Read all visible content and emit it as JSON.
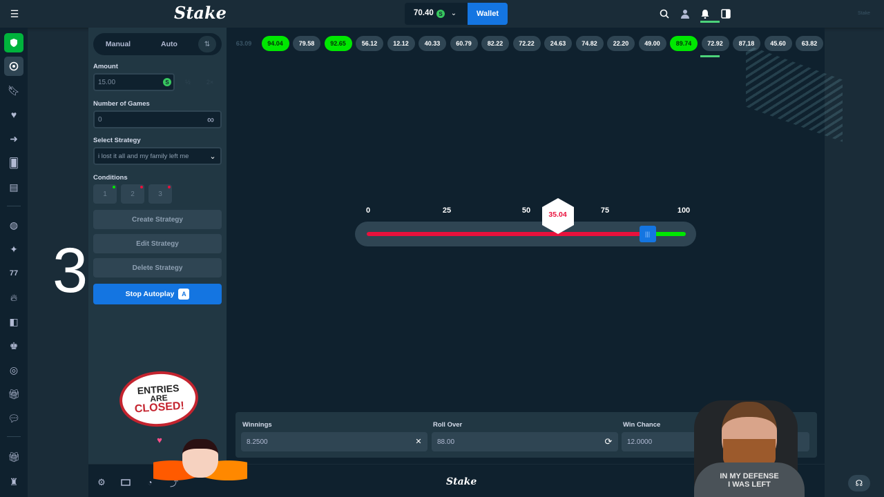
{
  "header": {
    "logo": "Stake",
    "balance": "70.40",
    "currency_symbol": "S",
    "wallet_label": "Wallet",
    "corner_text": "Stake"
  },
  "recent_results": [
    {
      "value": "63.09",
      "win": false,
      "faded": true
    },
    {
      "value": "94.04",
      "win": true
    },
    {
      "value": "79.58",
      "win": false
    },
    {
      "value": "92.65",
      "win": true
    },
    {
      "value": "56.12",
      "win": false
    },
    {
      "value": "12.12",
      "win": false
    },
    {
      "value": "40.33",
      "win": false
    },
    {
      "value": "60.79",
      "win": false
    },
    {
      "value": "82.22",
      "win": false
    },
    {
      "value": "72.22",
      "win": false
    },
    {
      "value": "24.63",
      "win": false
    },
    {
      "value": "74.82",
      "win": false
    },
    {
      "value": "22.20",
      "win": false
    },
    {
      "value": "49.00",
      "win": false
    },
    {
      "value": "89.74",
      "win": true
    },
    {
      "value": "72.92",
      "win": false
    },
    {
      "value": "87.18",
      "win": false
    },
    {
      "value": "45.60",
      "win": false
    },
    {
      "value": "63.82",
      "win": false
    }
  ],
  "bet_panel": {
    "tab_manual": "Manual",
    "tab_auto": "Auto",
    "amount_label": "Amount",
    "amount_value": "15.00",
    "half_label": "½",
    "double_label": "2×",
    "games_label": "Number of Games",
    "games_value": "0",
    "strategy_label": "Select Strategy",
    "strategy_value": "i lost it all and my family left me",
    "conditions_label": "Conditions",
    "conditions": [
      "1",
      "2",
      "3"
    ],
    "create_strategy": "Create Strategy",
    "edit_strategy": "Edit Strategy",
    "delete_strategy": "Delete Strategy",
    "stop_autoplay": "Stop Autoplay"
  },
  "overlay": {
    "countdown": "3",
    "sticker_text": [
      "ENTRIES",
      "ARE",
      "CLOSED!"
    ],
    "shirt_text": [
      "IN MY DEFENSE",
      "I WAS LEFT"
    ]
  },
  "slider": {
    "ticks": [
      "0",
      "25",
      "50",
      "75",
      "100"
    ],
    "result": "35.04",
    "result_fraction": 0.3504,
    "roll_over_fraction": 0.88,
    "lose_color": "#e9113c",
    "win_color": "#00e701"
  },
  "bottom_fields": {
    "winnings_label": "Winnings",
    "winnings_value": "8.2500",
    "roll_over_label": "Roll Over",
    "roll_over_value": "88.00",
    "win_chance_label": "Win Chance",
    "win_chance_value": "12.0000"
  },
  "footer": {
    "logo": "Stake"
  },
  "colors": {
    "accent": "#1475e1",
    "win": "#00e701",
    "lose": "#e9113c"
  }
}
